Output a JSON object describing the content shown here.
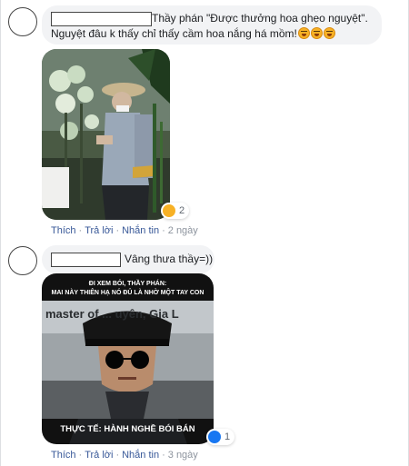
{
  "comments": [
    {
      "text": "Thầy phán \"Được thưởng hoa ghẹo nguyệt\". Nguyệt đâu k thấy chỉ thấy cầm hoa nắng há mồm!",
      "line1": "Thầy phán \"Được thưởng hoa ghẹo nguyệt\".",
      "line2": "Nguyệt đâu k thấy chỉ thấy cầm hoa nắng há mồm!",
      "emoji_icon": "laughing-crying-emoji",
      "emoji_count": 3,
      "reaction_icon": "haha-reaction-icon",
      "reaction_count": "2",
      "actions": {
        "like": "Thích",
        "reply": "Trả lời",
        "message": "Nhắn tin",
        "time": "2 ngày"
      }
    },
    {
      "text": "Vâng thưa thầy=))",
      "meme_top_line1": "ĐI XEM BÓI, THẦY PHÁN:",
      "meme_top_line2": "MAI NÀY THIÊN HẠ NÓ ĐỦ LÀ NHỜ MỘT TAY CON",
      "meme_banner": "master of ... uyên, Gia L",
      "meme_bottom": "THỰC TẾ: HÀNH NGHỀ BÓI BÁN",
      "reaction_icon": "like-reaction-icon",
      "reaction_count": "1",
      "actions": {
        "like": "Thích",
        "reply": "Trả lời",
        "message": "Nhắn tin",
        "time": "3 ngày"
      }
    }
  ],
  "colors": {
    "link": "#385898",
    "meta": "#8d949e",
    "bubble": "#f2f3f5",
    "like_blue": "#1877f2",
    "haha_yellow": "#f7b125"
  }
}
